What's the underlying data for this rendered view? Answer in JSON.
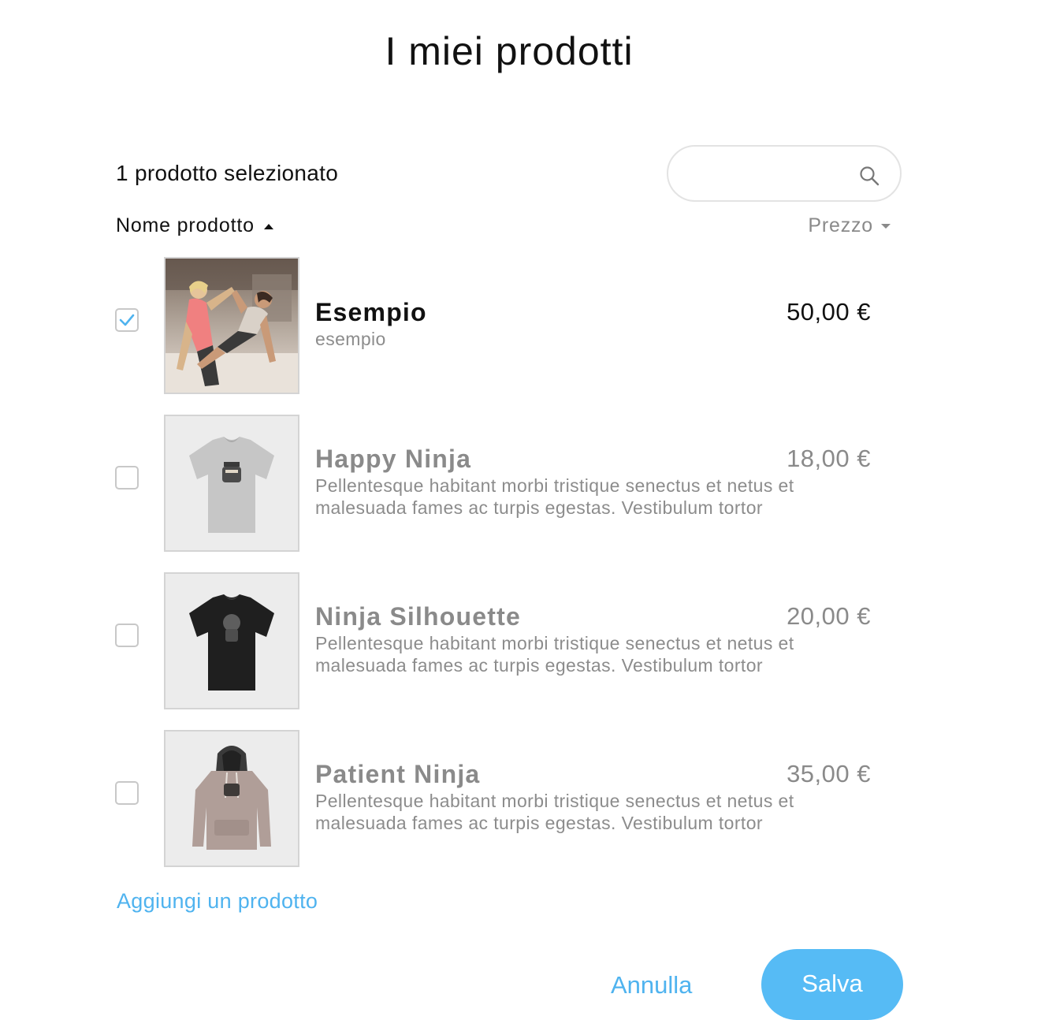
{
  "dialog": {
    "title": "I miei prodotti",
    "selected_count_text": "1 prodotto selezionato"
  },
  "search": {
    "placeholder": "",
    "value": "",
    "icon": "search-icon"
  },
  "columns": {
    "name_label": "Nome prodotto",
    "name_sort": "ascending",
    "price_label": "Prezzo",
    "price_sort": "dropdown"
  },
  "products": [
    {
      "name": "Esempio",
      "description": "esempio",
      "price": "50,00 €",
      "checked": true,
      "image": "fitness-photo"
    },
    {
      "name": "Happy Ninja",
      "description": "Pellentesque habitant morbi tristique senectus et netus et malesuada fames ac turpis egestas. Vestibulum tortor",
      "price": "18,00 €",
      "checked": false,
      "image": "grey-tshirt"
    },
    {
      "name": "Ninja Silhouette",
      "description": "Pellentesque habitant morbi tristique senectus et netus et malesuada fames ac turpis egestas. Vestibulum tortor",
      "price": "20,00 €",
      "checked": false,
      "image": "black-tshirt"
    },
    {
      "name": "Patient Ninja",
      "description": "Pellentesque habitant morbi tristique senectus et netus et malesuada fames ac turpis egestas. Vestibulum tortor",
      "price": "35,00 €",
      "checked": false,
      "image": "grey-hoodie"
    }
  ],
  "actions": {
    "add_product": "Aggiungi un prodotto",
    "cancel": "Annulla",
    "save": "Salva"
  },
  "colors": {
    "accent": "#4fb3ef",
    "save_button": "#56bbf5",
    "checkbox_border": "#c8c8c8",
    "muted_text": "#8a8a8a"
  }
}
